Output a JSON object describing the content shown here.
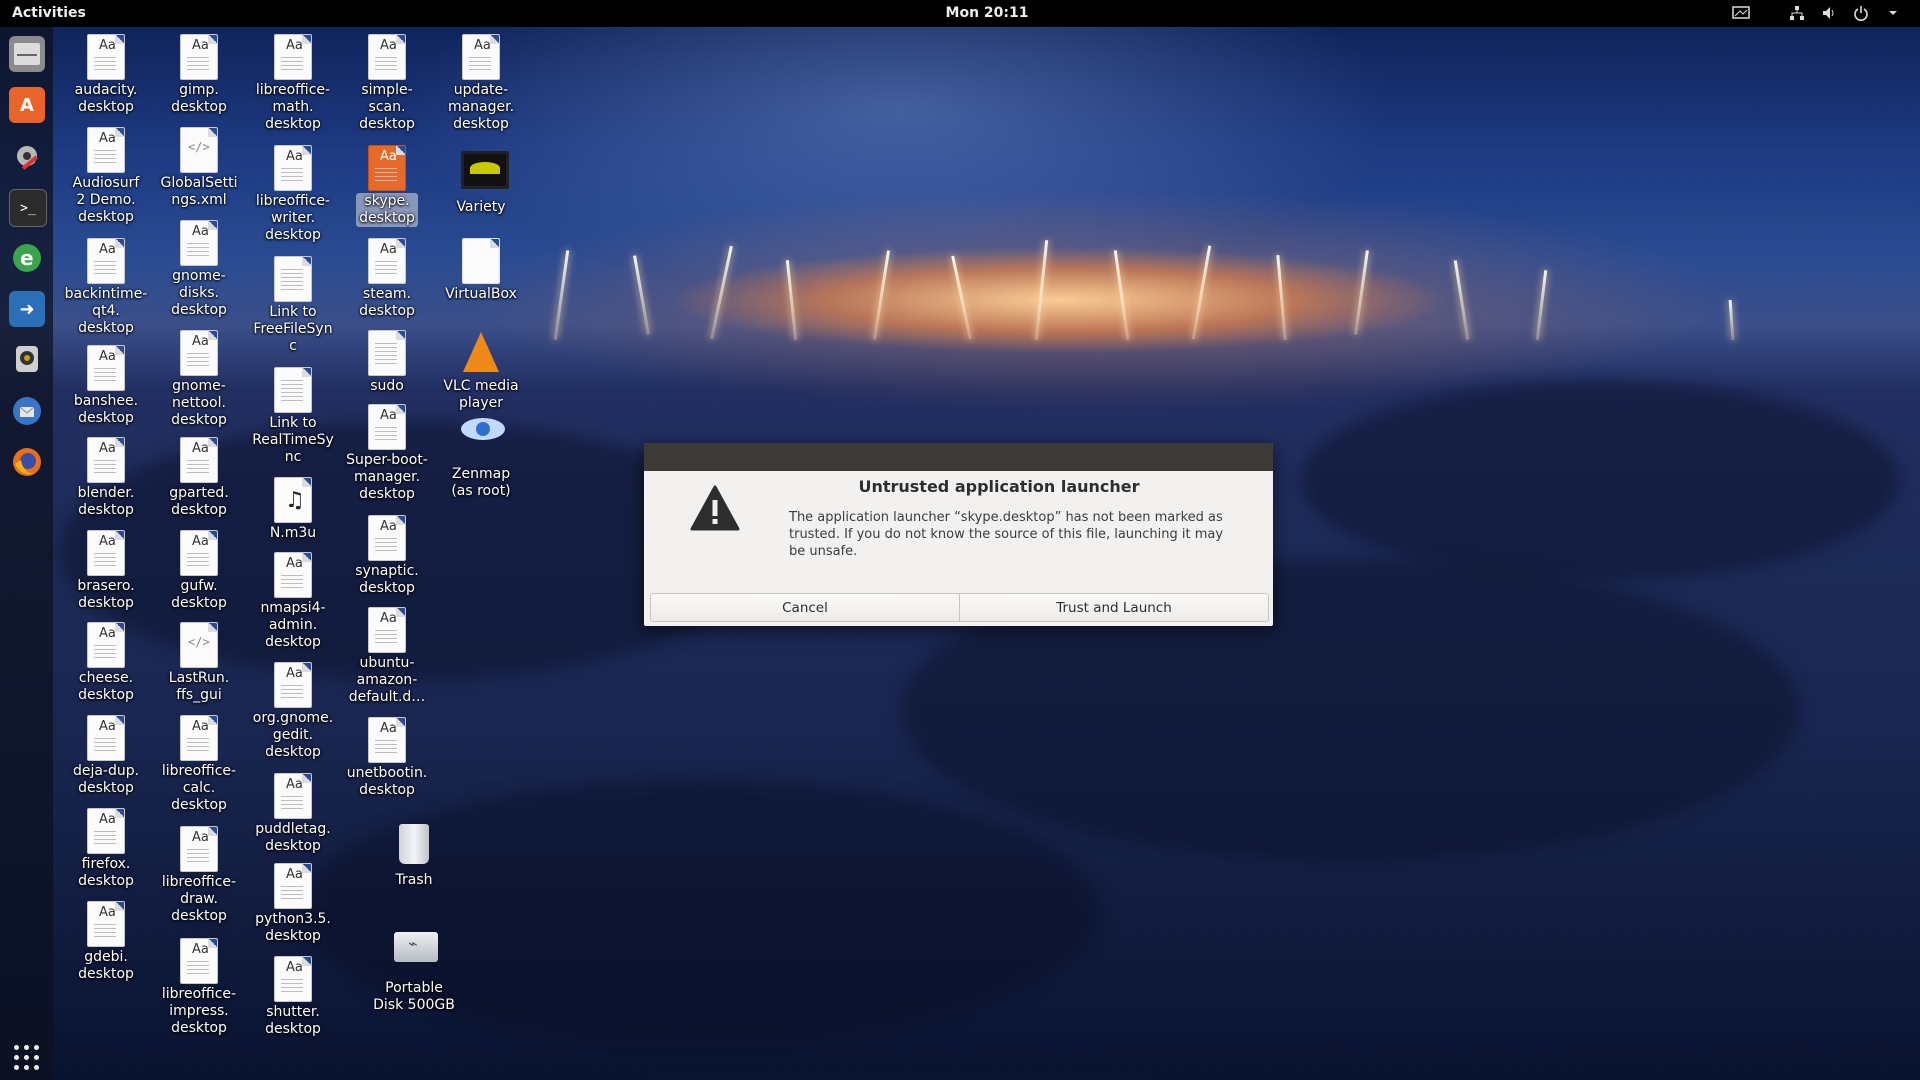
{
  "topbar": {
    "activities": "Activities",
    "clock": "Mon 20:11",
    "tray_icons": [
      "screen-icon",
      "network-icon",
      "volume-icon",
      "power-icon",
      "chevron-down-icon"
    ]
  },
  "dock": {
    "items": [
      {
        "name": "files-icon",
        "color": "#8b8b8b"
      },
      {
        "name": "software-center-icon",
        "color": "#e9642a"
      },
      {
        "name": "system-settings-icon",
        "color": "#b8b8b8"
      },
      {
        "name": "terminal-icon",
        "color": "#2b2b2b"
      },
      {
        "name": "browser-e-icon",
        "color": "#3aa34b"
      },
      {
        "name": "remote-desktop-icon",
        "color": "#2a6fb7"
      },
      {
        "name": "webcam-icon",
        "color": "#cfcfcf"
      },
      {
        "name": "thunderbird-icon",
        "color": "#3a74c4"
      },
      {
        "name": "firefox-icon",
        "color": "#e8701a"
      }
    ]
  },
  "desktop_icons": [
    {
      "label": "audacity.\ndesktop",
      "type": "doc"
    },
    {
      "label": "Audiosurf\n2 Demo.\ndesktop",
      "type": "doc"
    },
    {
      "label": "backintime-\nqt4.\ndesktop",
      "type": "doc"
    },
    {
      "label": "banshee.\ndesktop",
      "type": "doc"
    },
    {
      "label": "blender.\ndesktop",
      "type": "doc"
    },
    {
      "label": "brasero.\ndesktop",
      "type": "doc"
    },
    {
      "label": "cheese.\ndesktop",
      "type": "doc"
    },
    {
      "label": "deja-dup.\ndesktop",
      "type": "doc"
    },
    {
      "label": "firefox.\ndesktop",
      "type": "doc"
    },
    {
      "label": "gdebi.\ndesktop",
      "type": "doc"
    },
    {
      "label": "gimp.\ndesktop",
      "type": "doc"
    },
    {
      "label": "GlobalSetti\nngs.xml",
      "type": "xml"
    },
    {
      "label": "gnome-\ndisks.\ndesktop",
      "type": "doc"
    },
    {
      "label": "gnome-\nnettool.\ndesktop",
      "type": "doc"
    },
    {
      "label": "gparted.\ndesktop",
      "type": "doc"
    },
    {
      "label": "gufw.\ndesktop",
      "type": "doc"
    },
    {
      "label": "LastRun.\nffs_gui",
      "type": "xml"
    },
    {
      "label": "libreoffice-\ncalc.\ndesktop",
      "type": "doc"
    },
    {
      "label": "libreoffice-\ndraw.\ndesktop",
      "type": "doc"
    },
    {
      "label": "libreoffice-\nimpress.\ndesktop",
      "type": "doc"
    },
    {
      "label": "libreoffice-\nmath.\ndesktop",
      "type": "doc"
    },
    {
      "label": "libreoffice-\nwriter.\ndesktop",
      "type": "doc"
    },
    {
      "label": "Link to\nFreeFileSyn\nc",
      "type": "plain"
    },
    {
      "label": "Link to\nRealTimeSy\nnc",
      "type": "plain"
    },
    {
      "label": "N.m3u",
      "type": "music"
    },
    {
      "label": "nmapsi4-\nadmin.\ndesktop",
      "type": "doc"
    },
    {
      "label": "org.gnome.\ngedit.\ndesktop",
      "type": "doc"
    },
    {
      "label": "puddletag.\ndesktop",
      "type": "doc"
    },
    {
      "label": "python3.5.\ndesktop",
      "type": "doc"
    },
    {
      "label": "shutter.\ndesktop",
      "type": "doc"
    },
    {
      "label": "simple-\nscan.\ndesktop",
      "type": "doc"
    },
    {
      "label": "skype.\ndesktop",
      "type": "skype",
      "selected": true
    },
    {
      "label": "steam.\ndesktop",
      "type": "doc"
    },
    {
      "label": "sudo",
      "type": "plain"
    },
    {
      "label": "Super-boot-\nmanager.\ndesktop",
      "type": "doc"
    },
    {
      "label": "synaptic.\ndesktop",
      "type": "doc"
    },
    {
      "label": "ubuntu-\namazon-\ndefault.d…",
      "type": "doc"
    },
    {
      "label": "unetbootin.\ndesktop",
      "type": "doc"
    },
    {
      "label": "update-\nmanager.\ndesktop",
      "type": "doc"
    },
    {
      "label": "Variety",
      "type": "variety"
    },
    {
      "label": "VirtualBox",
      "type": "blank"
    },
    {
      "label": "VLC media\nplayer",
      "type": "vlc"
    },
    {
      "label": "Zenmap\n(as root)",
      "type": "zenmap"
    },
    {
      "label": "Trash",
      "type": "trash"
    },
    {
      "label": "Portable\nDisk 500GB",
      "type": "disk"
    }
  ],
  "dialog": {
    "title": "Untrusted application launcher",
    "message": "The application launcher “skype.desktop” has not been marked as trusted. If you do not know the source of this file, launching it may be unsafe.",
    "cancel_label": "Cancel",
    "trust_label": "Trust and Launch"
  }
}
